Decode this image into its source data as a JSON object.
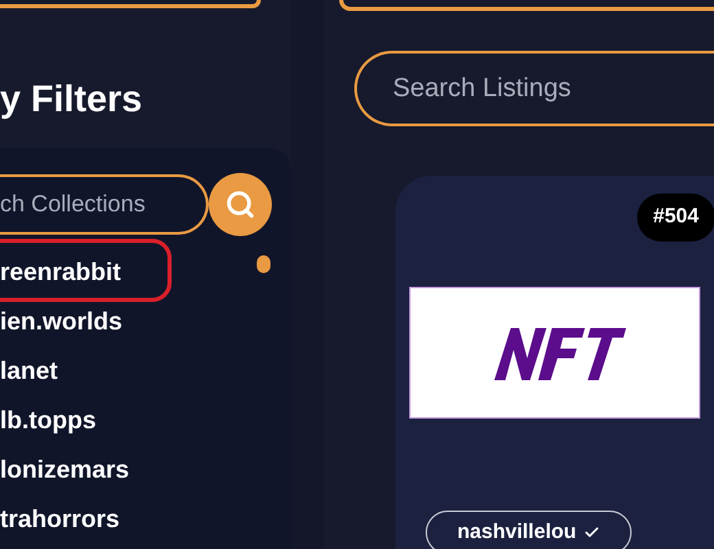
{
  "sidebar": {
    "heading": "y Filters",
    "search": {
      "placeholder": "ch Collections"
    },
    "collections": [
      {
        "name": "reenrabbit",
        "highlighted": true
      },
      {
        "name": "ien.worlds",
        "highlighted": false
      },
      {
        "name": "lanet",
        "highlighted": false
      },
      {
        "name": "lb.topps",
        "highlighted": false
      },
      {
        "name": "lonizemars",
        "highlighted": false
      },
      {
        "name": "trahorrors",
        "highlighted": false
      }
    ]
  },
  "listings": {
    "search": {
      "placeholder": "Search Listings"
    },
    "card": {
      "badge": "#504",
      "seller": "nashvillelou",
      "verified": true
    }
  }
}
